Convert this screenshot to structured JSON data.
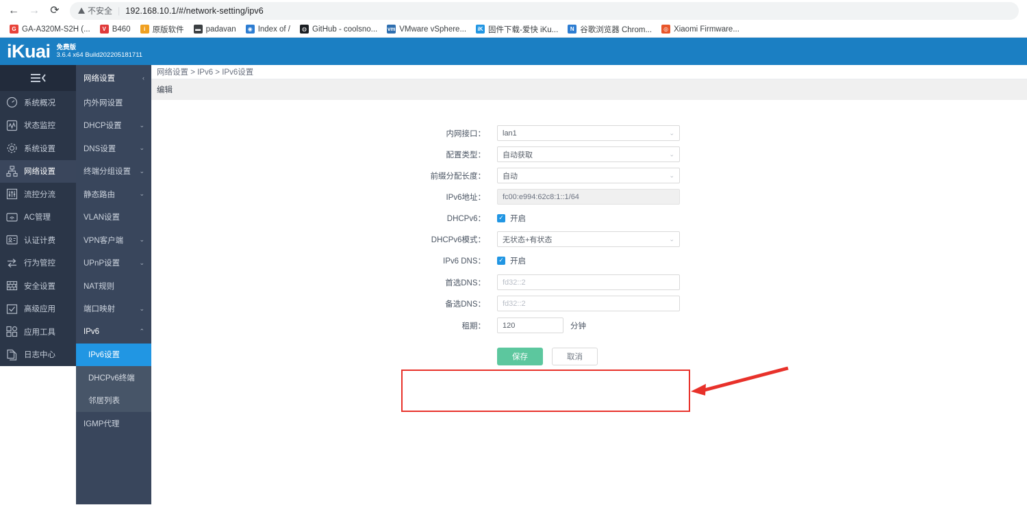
{
  "browser": {
    "back_icon": "←",
    "forward_icon": "→",
    "reload_icon": "⟳",
    "security_label": "不安全",
    "separator": "|",
    "url": "192.168.10.1/#/network-setting/ipv6",
    "bookmarks": [
      {
        "label": "GA-A320M-S2H (...",
        "icon": "G",
        "color": "#e8433a"
      },
      {
        "label": "B460",
        "icon": "V",
        "color": "#e03a3a"
      },
      {
        "label": "原版软件",
        "icon": "i",
        "color": "#f0a020"
      },
      {
        "label": "padavan",
        "icon": "▬",
        "color": "#3c4043"
      },
      {
        "label": "Index of /",
        "icon": "◉",
        "color": "#2d7dd2"
      },
      {
        "label": "GitHub - coolsno...",
        "icon": "◍",
        "color": "#1b1f23"
      },
      {
        "label": "VMware vSphere...",
        "icon": "vm",
        "color": "#2f6fb0"
      },
      {
        "label": "固件下载-爱快 iKu...",
        "icon": "iK",
        "color": "#2196e3"
      },
      {
        "label": "谷歌浏览器 Chrom...",
        "icon": "N",
        "color": "#2d7dd2"
      },
      {
        "label": "Xiaomi Firmware...",
        "icon": "◎",
        "color": "#e8562a"
      }
    ]
  },
  "app_header": {
    "logo": "iKuai",
    "edition": "免费版",
    "version": "3.6.4 x64 Build202205181711",
    "brand_color": "#1b7fc3"
  },
  "sidebar": {
    "collapse_icon": "collapse-menu-icon",
    "items": [
      {
        "label": "系统概况",
        "icon": "dashboard-icon",
        "active": false
      },
      {
        "label": "状态监控",
        "icon": "monitor-icon",
        "active": false
      },
      {
        "label": "系统设置",
        "icon": "gear-icon",
        "active": false
      },
      {
        "label": "网络设置",
        "icon": "network-icon",
        "active": true
      },
      {
        "label": "流控分流",
        "icon": "sliders-icon",
        "active": false
      },
      {
        "label": "AC管理",
        "icon": "wifi-icon",
        "active": false
      },
      {
        "label": "认证计费",
        "icon": "id-card-icon",
        "active": false
      },
      {
        "label": "行为管控",
        "icon": "arrows-icon",
        "active": false
      },
      {
        "label": "安全设置",
        "icon": "firewall-icon",
        "active": false
      },
      {
        "label": "高级应用",
        "icon": "check-box-icon",
        "active": false
      },
      {
        "label": "应用工具",
        "icon": "apps-icon",
        "active": false
      },
      {
        "label": "日志中心",
        "icon": "documents-icon",
        "active": false
      }
    ]
  },
  "subnav": {
    "title": "网络设置",
    "title_chevron": "‹",
    "items": [
      {
        "label": "内外网设置",
        "chevron": ""
      },
      {
        "label": "DHCP设置",
        "chevron": "⌄"
      },
      {
        "label": "DNS设置",
        "chevron": "⌄"
      },
      {
        "label": "终端分组设置",
        "chevron": "⌄"
      },
      {
        "label": "静态路由",
        "chevron": "⌄"
      },
      {
        "label": "VLAN设置",
        "chevron": ""
      },
      {
        "label": "VPN客户端",
        "chevron": "⌄"
      },
      {
        "label": "UPnP设置",
        "chevron": "⌄"
      },
      {
        "label": "NAT规则",
        "chevron": ""
      },
      {
        "label": "端口映射",
        "chevron": "⌄"
      }
    ],
    "ipv6": {
      "label": "IPv6",
      "chevron": "⌃",
      "children": [
        {
          "label": "IPv6设置",
          "active": true
        },
        {
          "label": "DHCPv6终端",
          "active": false
        },
        {
          "label": "邻居列表",
          "active": false
        }
      ]
    },
    "trailing": {
      "label": "IGMP代理",
      "chevron": ""
    },
    "active_color": "#2196e3"
  },
  "content": {
    "breadcrumb": "网络设置 > IPv6 > IPv6设置",
    "panel_title": "编辑",
    "form": {
      "lan_interface": {
        "label": "内网接口：",
        "value": "lan1",
        "type": "select"
      },
      "config_type": {
        "label": "配置类型：",
        "value": "自动获取",
        "type": "select"
      },
      "prefix_length": {
        "label": "前缀分配长度：",
        "value": "自动",
        "type": "select"
      },
      "ipv6_address": {
        "label": "IPv6地址：",
        "value": "fc00:e994:62c8:1::1/64",
        "type": "readonly"
      },
      "dhcpv6": {
        "label": "DHCPv6：",
        "checkbox_label": "开启",
        "checked": true
      },
      "dhcpv6_mode": {
        "label": "DHCPv6模式：",
        "value": "无状态+有状态",
        "type": "select"
      },
      "ipv6_dns": {
        "label": "IPv6 DNS：",
        "checkbox_label": "开启",
        "checked": true
      },
      "primary_dns": {
        "label": "首选DNS：",
        "value": "",
        "placeholder": "fd32::2",
        "type": "input"
      },
      "secondary_dns": {
        "label": "备选DNS：",
        "value": "",
        "placeholder": "fd32::2",
        "type": "input"
      },
      "lease": {
        "label": "租期：",
        "value": "120",
        "unit": "分钟",
        "type": "input"
      }
    },
    "buttons": {
      "save": "保存",
      "cancel": "取消",
      "save_color": "#5cc79e"
    },
    "annotation": {
      "highlight_color": "#e8312a",
      "arrow": "left-pointing-arrow"
    }
  }
}
